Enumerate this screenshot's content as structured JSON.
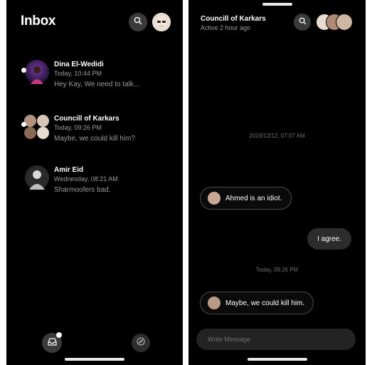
{
  "inbox": {
    "title": "Inbox",
    "conversations": [
      {
        "name": "Dina El-Wedidi",
        "time": "Today, 10:44 PM",
        "preview": "Hey Kay, We need to talk...",
        "unread": true
      },
      {
        "name": "Councill of Karkars",
        "time": "Today, 09:26 PM",
        "preview": "Maybe, we could kill him?",
        "unread": true
      },
      {
        "name": "Amir Eid",
        "time": "Wednesday, 08:21 AM",
        "preview": "Sharmoofers bad.",
        "unread": false
      }
    ]
  },
  "chat": {
    "title": "Councill of Karkars",
    "status": "Active 2 hour ago",
    "messages": [
      {
        "kind": "date",
        "text": "2019/12/12, 07:07 AM"
      },
      {
        "kind": "incoming",
        "text": "Ahmed is an idiot."
      },
      {
        "kind": "outgoing",
        "text": "I agree."
      },
      {
        "kind": "date",
        "text": "Today, 09:26 PM"
      },
      {
        "kind": "incoming",
        "text": "Maybe, we could kill him."
      }
    ],
    "composer_placeholder": "Write Message"
  },
  "icons": {
    "search": "search-icon",
    "inbox_tab": "inbox-tray-icon",
    "explore_tab": "compass-icon"
  },
  "colors": {
    "background": "#000000",
    "secondary_text": "#9a9a9a",
    "bubble_outgoing": "#2c2c2c",
    "button_bg": "#3a3a3a"
  }
}
